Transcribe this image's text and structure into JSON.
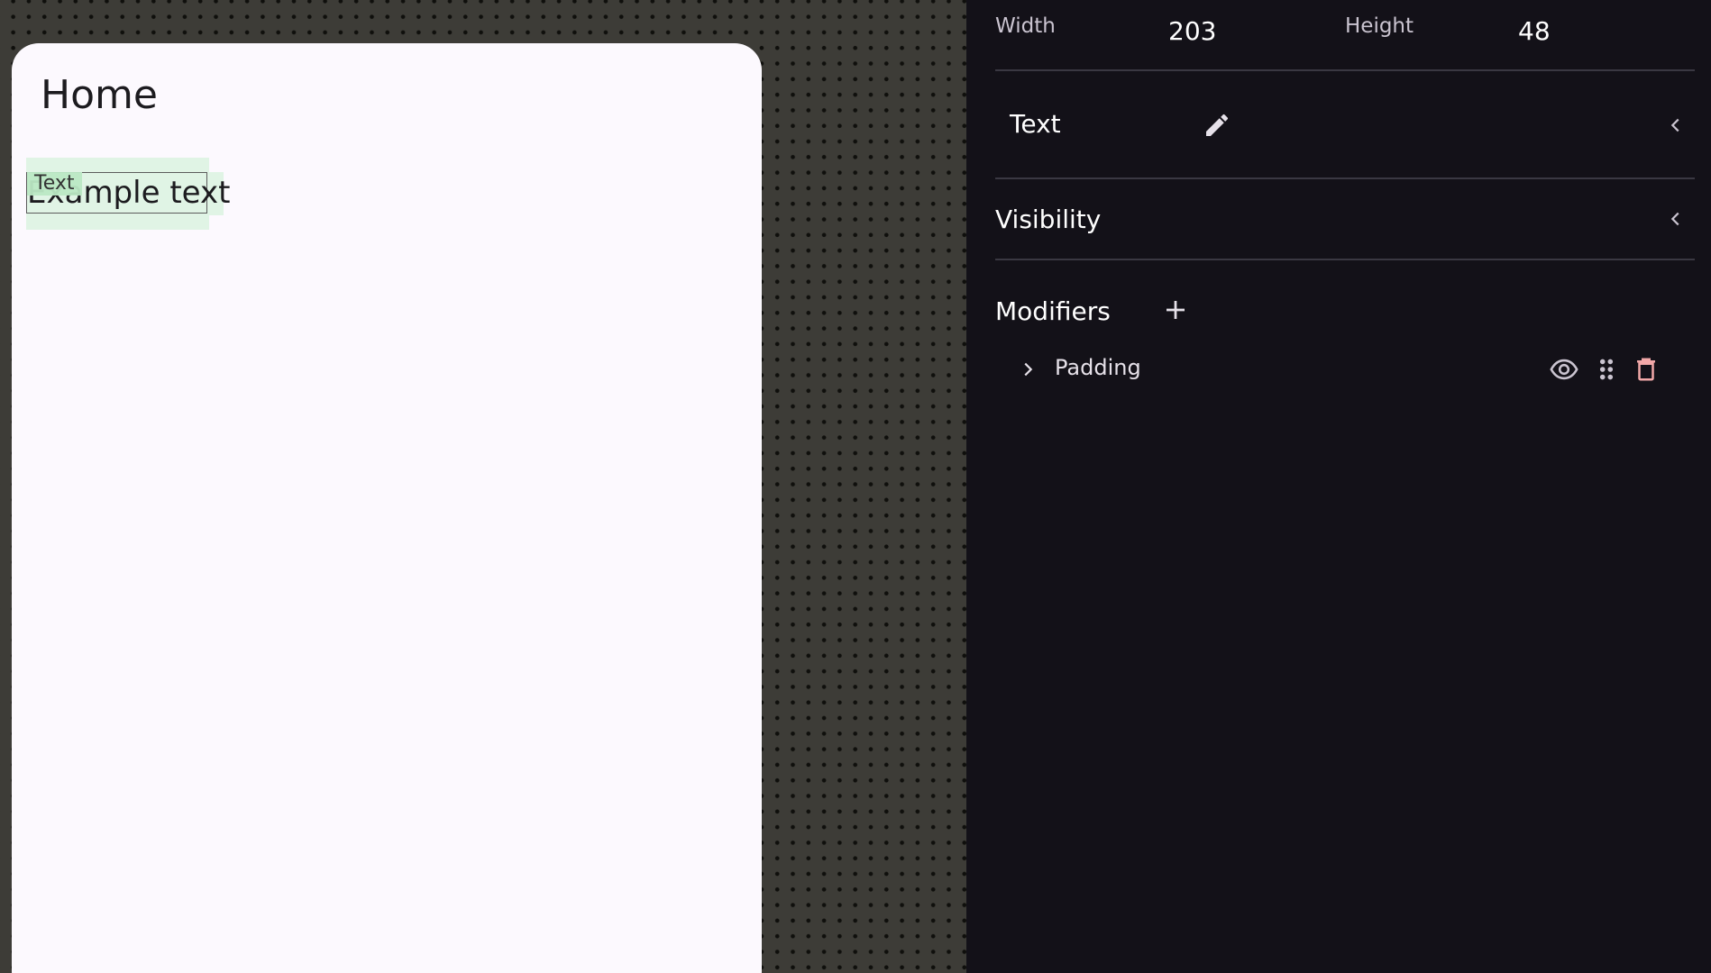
{
  "canvas": {
    "screen_title": "Home",
    "selected_node_tag": "Text",
    "selected_node_text": "Example text"
  },
  "panel": {
    "dimensions": {
      "width_label": "Width",
      "width_value": "203",
      "height_label": "Height",
      "height_value": "48"
    },
    "text_section": {
      "title": "Text",
      "edit_icon": "pencil-icon",
      "toggle_icon": "chevron-left-icon"
    },
    "visibility_section": {
      "title": "Visibility",
      "toggle_icon": "chevron-left-icon"
    },
    "modifiers_section": {
      "title": "Modifiers",
      "add_icon": "plus-icon",
      "items": [
        {
          "label": "Padding",
          "icons": [
            "chevron-right-icon",
            "eye-icon",
            "drag-handle-icon",
            "trash-icon"
          ]
        }
      ]
    }
  },
  "colors": {
    "canvas_bg": "#3d3c37",
    "device_bg": "#fcf9fe",
    "panel_bg": "#131118",
    "divider": "#3a3842",
    "selection_highlight": "#c8f0d0",
    "delete_accent": "#f2a8a8"
  }
}
